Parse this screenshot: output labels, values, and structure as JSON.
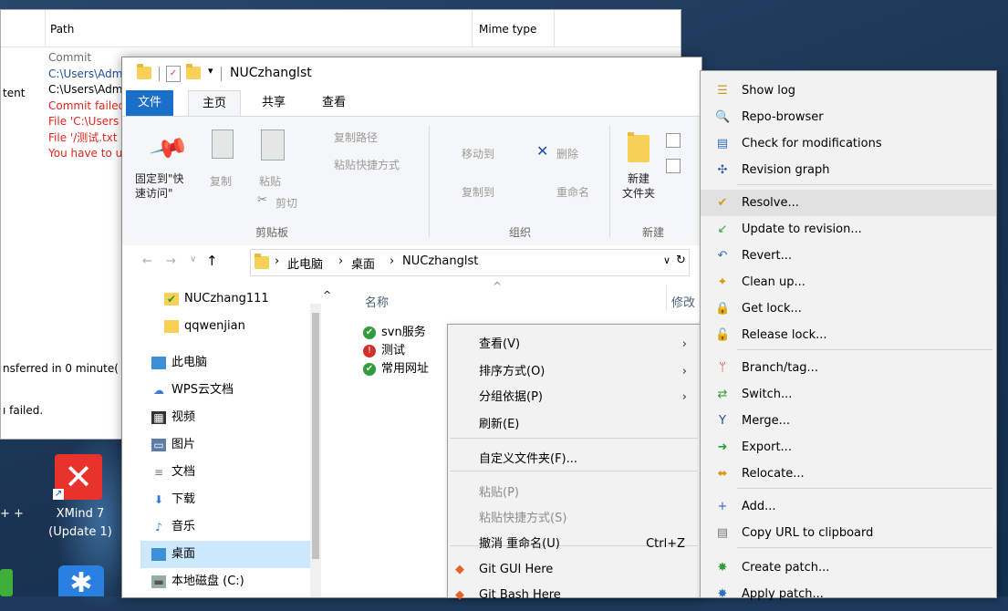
{
  "log_window": {
    "col_path": "Path",
    "col_mime": "Mime type",
    "left_labels": [
      "tent",
      "nsferred in 0 minute(",
      "ı failed."
    ],
    "lines": [
      {
        "text": "Commit",
        "color": "#6b6b6b"
      },
      {
        "text": "C:\\Users\\Adm",
        "color": "#1f4fa0"
      },
      {
        "text": "C:\\Users\\Adm",
        "color": "#000000"
      },
      {
        "text": "Commit failed",
        "color": "#e0251b"
      },
      {
        "text": "File 'C:\\Users",
        "color": "#e0251b"
      },
      {
        "text": "File '/测试.txt",
        "color": "#e0251b"
      },
      {
        "text": "You have to u",
        "color": "#e0251b"
      }
    ]
  },
  "explorer": {
    "title": "NUCzhanglst",
    "tabs": [
      "文件",
      "主页",
      "共享",
      "查看"
    ],
    "ribbon": {
      "pin": "固定到\"快\n速访问\"",
      "copy": "复制",
      "paste": "粘贴",
      "copy_path": "复制路径",
      "paste_shortcut": "粘贴快捷方式",
      "cut": "剪切",
      "group_clipboard": "剪贴板",
      "move_to": "移动到",
      "delete": "删除",
      "copy_to": "复制到",
      "rename": "重命名",
      "group_organize": "组织",
      "new_folder": "新建\n文件夹",
      "group_new": "新建"
    },
    "address": {
      "pc": "此电脑",
      "desktop": "桌面",
      "folder": "NUCzhanglst"
    },
    "nav_items": [
      {
        "label": "NUCzhang111",
        "icon": "svn-folder-icon"
      },
      {
        "label": "qqwenjian",
        "icon": "folder-icon"
      },
      {
        "label": "此电脑",
        "icon": "computer-icon"
      },
      {
        "label": "WPS云文档",
        "icon": "cloud-icon"
      },
      {
        "label": "视频",
        "icon": "video-icon"
      },
      {
        "label": "图片",
        "icon": "picture-icon"
      },
      {
        "label": "文档",
        "icon": "document-icon"
      },
      {
        "label": "下载",
        "icon": "download-icon"
      },
      {
        "label": "音乐",
        "icon": "music-icon"
      },
      {
        "label": "桌面",
        "icon": "desktop-icon"
      },
      {
        "label": "本地磁盘 (C:)",
        "icon": "drive-icon"
      }
    ],
    "column_name": "名称",
    "column_modified": "修改",
    "files": [
      {
        "label": "svn服务",
        "icon": "svn-ok-icon"
      },
      {
        "label": "测试",
        "icon": "svn-conflict-icon"
      },
      {
        "label": "常用网址",
        "icon": "svn-ok-icon"
      }
    ]
  },
  "context_menu": {
    "items": [
      {
        "label": "查看(V)",
        "arrow": true
      },
      {
        "label": "排序方式(O)",
        "arrow": true
      },
      {
        "label": "分组依据(P)",
        "arrow": true
      },
      {
        "label": "刷新(E)"
      },
      {
        "label": "自定义文件夹(F)..."
      },
      {
        "label": "粘贴(P)",
        "disabled": true
      },
      {
        "label": "粘贴快捷方式(S)",
        "disabled": true
      },
      {
        "label": "撤消 重命名(U)",
        "shortcut": "Ctrl+Z"
      },
      {
        "label": "Git GUI Here"
      },
      {
        "label": "Git Bash Here"
      }
    ]
  },
  "tortoise_menu": {
    "items": [
      {
        "label": "Show log",
        "icon": "show-log-icon"
      },
      {
        "label": "Repo-browser",
        "icon": "repo-browser-icon"
      },
      {
        "label": "Check for modifications",
        "icon": "check-modifications-icon"
      },
      {
        "label": "Revision graph",
        "icon": "revision-graph-icon"
      },
      {
        "label": "Resolve...",
        "icon": "resolve-icon"
      },
      {
        "label": "Update to revision...",
        "icon": "update-icon"
      },
      {
        "label": "Revert...",
        "icon": "revert-icon"
      },
      {
        "label": "Clean up...",
        "icon": "cleanup-icon"
      },
      {
        "label": "Get lock...",
        "icon": "lock-icon"
      },
      {
        "label": "Release lock...",
        "icon": "unlock-icon"
      },
      {
        "label": "Branch/tag...",
        "icon": "branch-icon"
      },
      {
        "label": "Switch...",
        "icon": "switch-icon"
      },
      {
        "label": "Merge...",
        "icon": "merge-icon"
      },
      {
        "label": "Export...",
        "icon": "export-icon"
      },
      {
        "label": "Relocate...",
        "icon": "relocate-icon"
      },
      {
        "label": "Add...",
        "icon": "add-icon"
      },
      {
        "label": "Copy URL to clipboard",
        "icon": "copy-url-icon"
      },
      {
        "label": "Create patch...",
        "icon": "create-patch-icon"
      },
      {
        "label": "Apply patch...",
        "icon": "apply-patch-icon"
      }
    ]
  },
  "desktop_icons": {
    "xmind_label_1": "XMind 7",
    "xmind_label_2": "(Update 1)",
    "partial_label": "+ +"
  },
  "colors": {
    "accent": "#1a6fc9",
    "error": "#e0251b",
    "menu_bg": "#f2f2f2"
  }
}
